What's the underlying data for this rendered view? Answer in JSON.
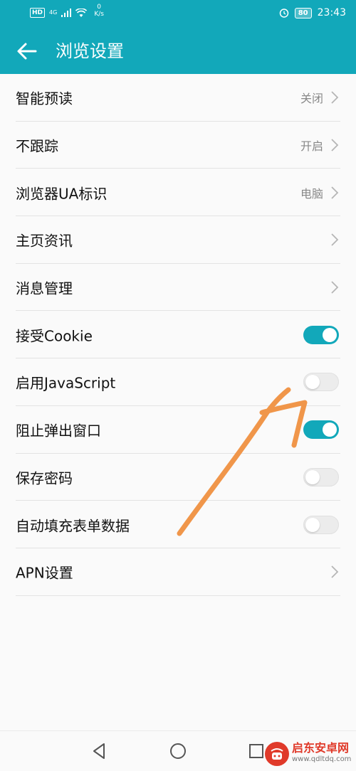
{
  "status_bar": {
    "hd": "HD",
    "network": "4G",
    "speed_value": "0",
    "speed_unit": "K/s",
    "battery": "80",
    "time": "23:43"
  },
  "app_bar": {
    "title": "浏览设置"
  },
  "settings": [
    {
      "label": "智能预读",
      "value": "关闭",
      "control": "chevron"
    },
    {
      "label": "不跟踪",
      "value": "开启",
      "control": "chevron"
    },
    {
      "label": "浏览器UA标识",
      "value": "电脑",
      "control": "chevron"
    },
    {
      "label": "主页资讯",
      "value": "",
      "control": "chevron"
    },
    {
      "label": "消息管理",
      "value": "",
      "control": "chevron"
    },
    {
      "label": "接受Cookie",
      "control": "toggle",
      "on": true
    },
    {
      "label": "启用JavaScript",
      "control": "toggle",
      "on": false
    },
    {
      "label": "阻止弹出窗口",
      "control": "toggle",
      "on": true
    },
    {
      "label": "保存密码",
      "control": "toggle",
      "on": false
    },
    {
      "label": "自动填充表单数据",
      "control": "toggle",
      "on": false
    },
    {
      "label": "APN设置",
      "value": "",
      "control": "chevron"
    }
  ],
  "colors": {
    "accent": "#12a8ba",
    "annotation": "#f0964a",
    "watermark_red": "#e03a2a"
  },
  "watermark": {
    "name": "启东安卓网",
    "url": "www.qdltdq.com"
  }
}
